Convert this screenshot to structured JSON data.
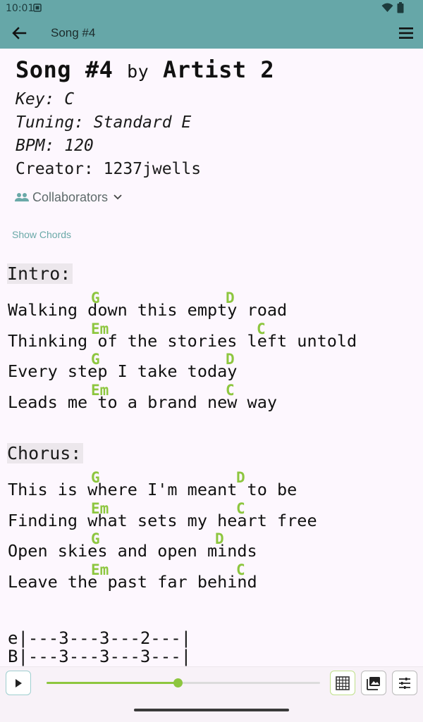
{
  "status": {
    "time": "10:01"
  },
  "appbar": {
    "title": "Song #4"
  },
  "song": {
    "name": "Song #4",
    "by": "by",
    "artist": "Artist 2",
    "key": "Key: C",
    "tuning": "Tuning: Standard E",
    "bpm": "BPM: 120",
    "creator": "Creator: 1237jwells",
    "collaborators_label": "Collaborators",
    "show_chords_label": "Show Chords"
  },
  "sections": {
    "intro": {
      "label": "Intro:",
      "lines": [
        "Walking down this empty road",
        "Thinking of the stories left untold",
        "Every step I take today",
        "Leads me to a brand new way"
      ],
      "chords": [
        "G",
        "D",
        "Em",
        "C",
        "G",
        "D",
        "Em",
        "C"
      ]
    },
    "chorus": {
      "label": "Chorus:",
      "lines": [
        "This is where I'm meant to be",
        "Finding what sets my heart free",
        "Open skies and open minds",
        "Leave the past far behind"
      ],
      "chords": [
        "G",
        "D",
        "Em",
        "C",
        "G",
        "D",
        "Em",
        "C"
      ]
    }
  },
  "tab_lines": [
    "e|---3---3---2---|",
    "B|---3---3---3---|"
  ],
  "player": {
    "progress": 0.48
  },
  "colors": {
    "accent": "#66a7a8",
    "chord": "#8dc63f",
    "background": "#fdf7fe"
  },
  "icons": [
    "back-arrow-icon",
    "hamburger-menu-icon",
    "people-icon",
    "chevron-down-icon",
    "play-icon",
    "grid-icon",
    "photo-library-icon",
    "tune-icon",
    "wifi-icon",
    "battery-icon"
  ]
}
